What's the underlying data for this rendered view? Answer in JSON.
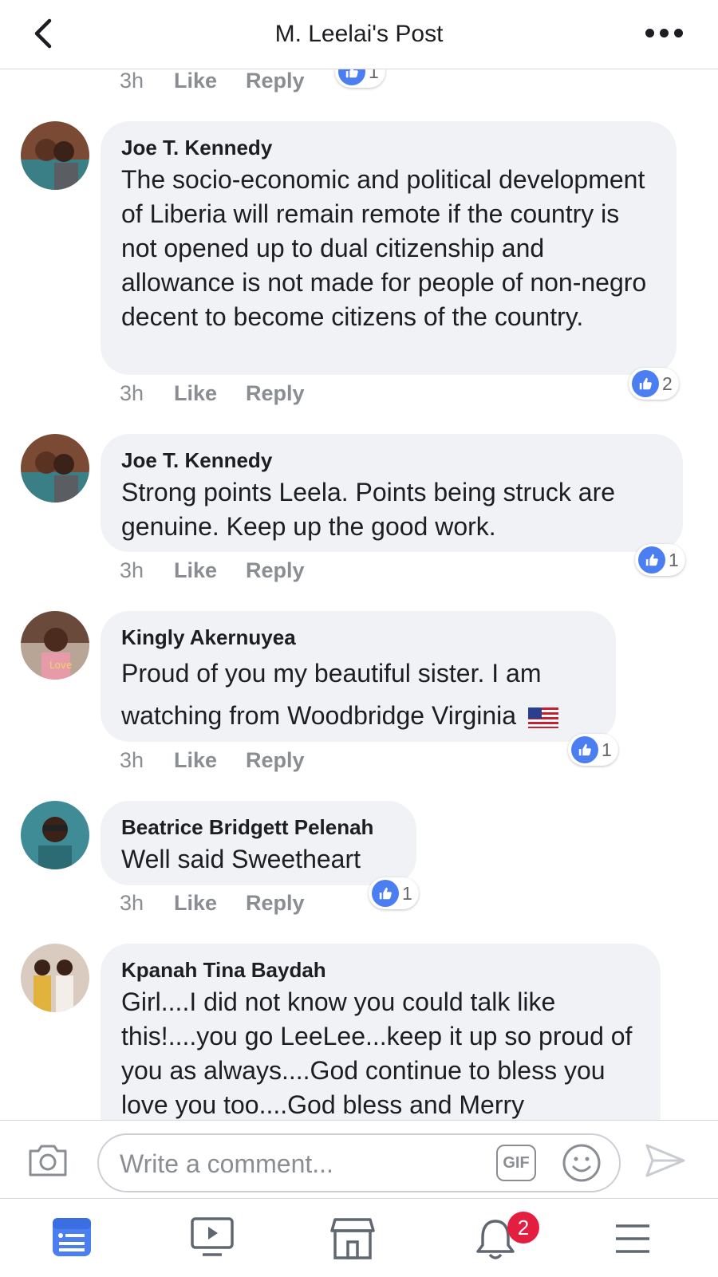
{
  "header": {
    "title": "M. Leelai's Post"
  },
  "meta_labels": {
    "like": "Like",
    "reply": "Reply"
  },
  "top_partial": {
    "time": "3h",
    "like_count": "1"
  },
  "comments": [
    {
      "author": "Joe T. Kennedy",
      "text": "The socio-economic and political development of Liberia will remain remote if the country is not opened up to dual citizenship and allowance is not made for people of non-negro decent to become citizens of the country.",
      "time": "3h",
      "like_count": "2"
    },
    {
      "author": "Joe T. Kennedy",
      "text": "Strong points Leela.  Points being struck are genuine. Keep up the good work.",
      "time": "3h",
      "like_count": "1"
    },
    {
      "author": "Kingly Akernuyea",
      "text": "Proud of you my beautiful sister. I am watching from Woodbridge Virginia",
      "time": "3h",
      "like_count": "1"
    },
    {
      "author": "Beatrice Bridgett Pelenah",
      "text": "Well said Sweetheart",
      "time": "3h",
      "like_count": "1"
    },
    {
      "author": "Kpanah Tina Baydah",
      "text": "Girl....I did not know you could talk like this!....you go LeeLee...keep it up so proud of you as always....God continue to bless you love you too....God bless and Merry",
      "time": "",
      "like_count": ""
    }
  ],
  "composer": {
    "placeholder": "Write a comment...",
    "gif_label": "GIF"
  },
  "tabbar": {
    "notification_count": "2"
  },
  "colors": {
    "accent": "#4b7ef0",
    "bubble": "#f0f2f5",
    "badge": "#e41e3f"
  }
}
